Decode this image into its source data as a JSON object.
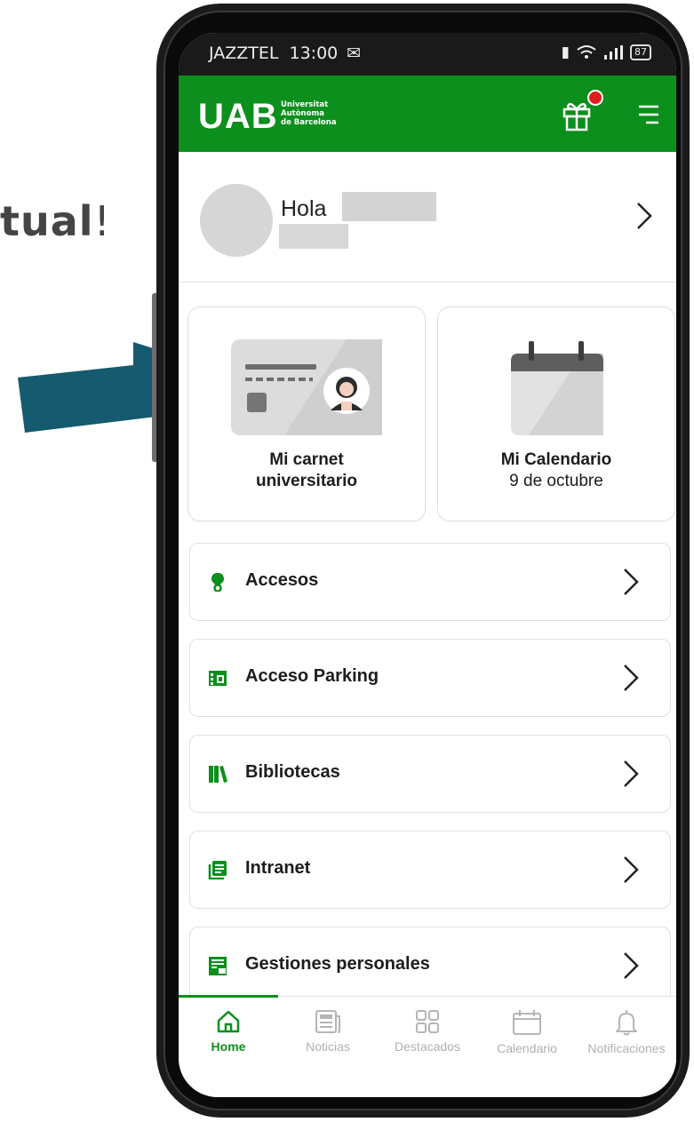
{
  "slide": {
    "partial_text": "tual",
    "exclaim": "!"
  },
  "status_bar": {
    "carrier": "JAZZTEL",
    "time": "13:00",
    "battery": "87"
  },
  "header": {
    "logo": "UAB",
    "logo_line1": "Universitat",
    "logo_line2": "Autònoma",
    "logo_line3": "de Barcelona"
  },
  "user": {
    "greeting": "Hola"
  },
  "cards": [
    {
      "line1": "Mi carnet",
      "line2": "universitario"
    },
    {
      "line1": "Mi Calendario",
      "line2": "9 de octubre"
    }
  ],
  "items": [
    {
      "label": "Accesos",
      "icon": "access-icon"
    },
    {
      "label": "Acceso Parking",
      "icon": "parking-icon"
    },
    {
      "label": "Bibliotecas",
      "icon": "library-icon"
    },
    {
      "label": "Intranet",
      "icon": "intranet-icon"
    },
    {
      "label": "Gestiones personales",
      "icon": "personal-procedures-icon"
    }
  ],
  "nav": [
    {
      "label": "Home",
      "icon": "home-icon",
      "active": true
    },
    {
      "label": "Noticias",
      "icon": "news-icon"
    },
    {
      "label": "Destacados",
      "icon": "grid-icon"
    },
    {
      "label": "Calendario",
      "icon": "calendar-icon"
    },
    {
      "label": "Notificaciones",
      "icon": "bell-icon"
    }
  ],
  "colors": {
    "brand_green": "#0c8f1c",
    "arrow": "#155a6e",
    "notification_dot": "#e02020"
  }
}
